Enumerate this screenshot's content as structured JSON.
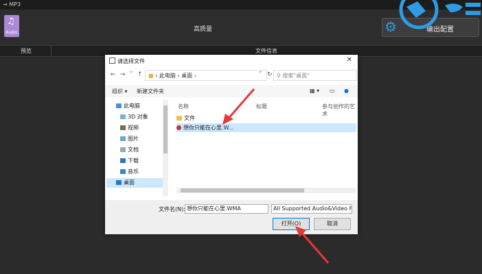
{
  "topbar": {
    "crumb": "→ MP3"
  },
  "toolbar": {
    "audio_label": "Audio",
    "quality_label": "高质量",
    "output_settings_label": "输出配置"
  },
  "header_row": {
    "preview_label": "预览",
    "file_info_label": "文件信息"
  },
  "dialog": {
    "title": "请选择文件",
    "close_icon": "✕",
    "address_path": [
      "此电脑",
      "桌面"
    ],
    "search_placeholder": "搜索\"桌面\"",
    "commands": {
      "organize": "组织 ▾",
      "new_folder": "新建文件夹"
    },
    "tree_items": [
      {
        "label": "此电脑",
        "icon": "computer-icon"
      },
      {
        "label": "3D 对象",
        "icon": "folder-icon"
      },
      {
        "label": "视频",
        "icon": "folder-icon"
      },
      {
        "label": "图片",
        "icon": "folder-icon"
      },
      {
        "label": "文档",
        "icon": "folder-icon"
      },
      {
        "label": "下载",
        "icon": "download-icon"
      },
      {
        "label": "音乐",
        "icon": "music-icon"
      },
      {
        "label": "桌面",
        "icon": "folder-icon"
      }
    ],
    "columns": [
      "名称",
      "标题",
      "参与创作的艺术"
    ],
    "files": [
      {
        "name": "文件",
        "icon": "folder-icon"
      },
      {
        "name": "想你只能在心里.W...",
        "icon": "audio-file-icon"
      }
    ],
    "filename_label": "文件名(N):",
    "filename_value": "想你只能在心里.WMA",
    "filetype_value": "All Supported Audio&Video F",
    "open_label": "打开(O)",
    "cancel_label": "取消"
  },
  "colors": {
    "accent": "#2f9be5",
    "arrow": "#e53935",
    "selection": "#cce8ff"
  }
}
